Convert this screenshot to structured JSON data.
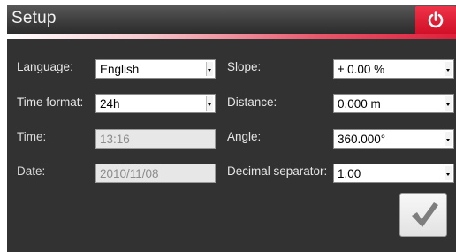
{
  "window": {
    "title": "Setup"
  },
  "form": {
    "language": {
      "label": "Language:",
      "value": "English"
    },
    "time_format": {
      "label": "Time format:",
      "value": "24h"
    },
    "time": {
      "label": "Time:",
      "value": "13:16"
    },
    "date": {
      "label": "Date:",
      "value": "2010/11/08"
    },
    "slope": {
      "label": "Slope:",
      "value": "± 0.00 %"
    },
    "distance": {
      "label": "Distance:",
      "value": "0.000 m"
    },
    "angle": {
      "label": "Angle:",
      "value": "360.000°"
    },
    "decimal_separator": {
      "label": "Decimal separator:",
      "value": "1.00"
    }
  },
  "icons": {
    "power": "power-icon",
    "confirm": "checkmark-icon"
  },
  "colors": {
    "accent_red": "#de1f3a",
    "panel_bg": "#323232"
  }
}
